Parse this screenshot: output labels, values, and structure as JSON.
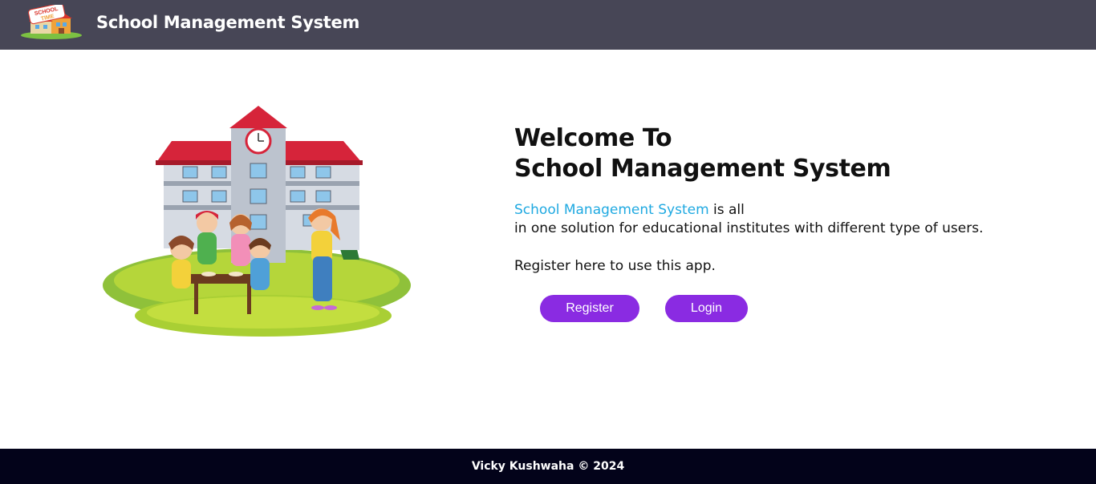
{
  "navbar": {
    "title": "School Management System",
    "logo_icon": "school-time-logo-icon",
    "logo_text_line1": "SCHOOL",
    "logo_text_line2": "TIME"
  },
  "hero": {
    "illustration_icon": "school-building-children-illustration",
    "welcome_line1": "Welcome To",
    "welcome_line2": "School Management System",
    "description_highlight": "School Management System",
    "description_rest_line1": " is all",
    "description_line2": "in one solution for educational institutes with different type of users.",
    "register_note": "Register here to use this app.",
    "register_label": "Register",
    "login_label": "Login"
  },
  "footer": {
    "text": "Vicky Kushwaha © 2024"
  },
  "colors": {
    "navbar_bg": "#474656",
    "footer_bg": "#03031a",
    "button_bg": "#8a2be2",
    "highlight": "#1fa9e1"
  }
}
